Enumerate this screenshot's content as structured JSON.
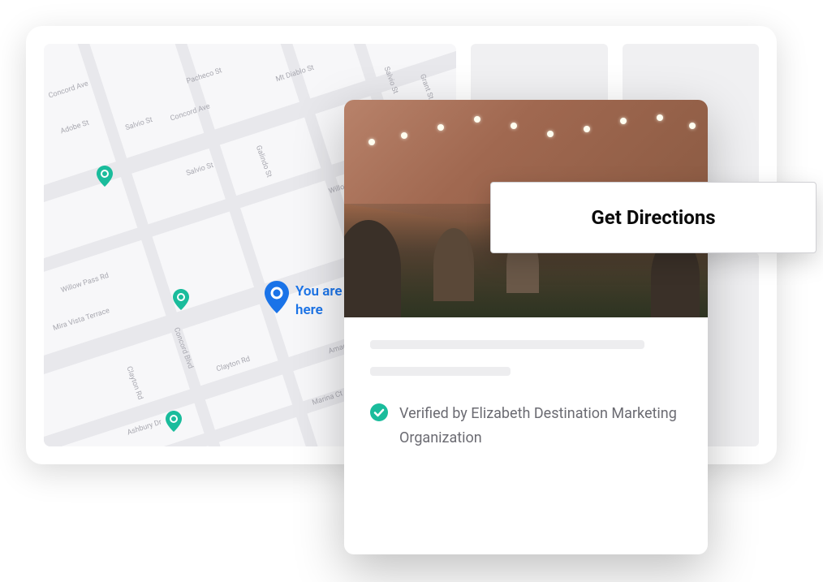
{
  "map": {
    "you_are_here_label": "You are here",
    "streets": [
      "Concord Ave",
      "Pacheco St",
      "Mt Diablo St",
      "Salvio St",
      "Grant St",
      "Adobe St",
      "Salvio St",
      "Galindo St",
      "Willow Pass Rd",
      "Willow Pass Rd",
      "Mira Vista Terrace",
      "Concord Blvd",
      "Clayton Rd",
      "Amador Ct",
      "Ashbury Dr",
      "Marina Ct"
    ],
    "pins": [
      {
        "type": "teal",
        "icon": "map-pin-icon"
      },
      {
        "type": "teal",
        "icon": "map-pin-icon"
      },
      {
        "type": "teal",
        "icon": "map-pin-icon"
      },
      {
        "type": "teal",
        "icon": "map-pin-icon"
      },
      {
        "type": "blue",
        "icon": "location-icon"
      }
    ]
  },
  "detail": {
    "verified_text": "Verified by Elizabeth Destination Marketing  Organization",
    "verified_icon": "checkmark-circle-icon"
  },
  "actions": {
    "get_directions_label": "Get Directions"
  },
  "colors": {
    "teal": "#1abc9c",
    "blue": "#1a73e8",
    "skeleton": "#ededef"
  }
}
